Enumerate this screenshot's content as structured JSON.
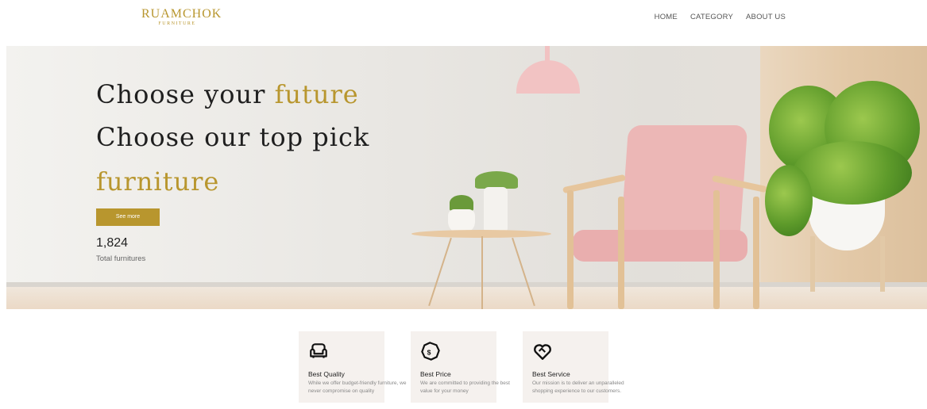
{
  "brand": {
    "name": "RUAMCHOK",
    "tagline": "FURNITURE"
  },
  "nav": {
    "items": [
      {
        "label": "HOME"
      },
      {
        "label": "CATEGORY"
      },
      {
        "label": "ABOUT US"
      }
    ]
  },
  "hero": {
    "line1_prefix": "Choose your ",
    "line1_highlight": "future",
    "line2": "Choose our top pick",
    "line3_highlight": "furniture",
    "cta_label": "See more",
    "stat_value": "1,824",
    "stat_label": "Total furnitures"
  },
  "features": [
    {
      "icon": "armchair-icon",
      "title": "Best Quality",
      "desc": "While we offer budget-friendly furniture, we never compromise on quality"
    },
    {
      "icon": "price-tag-icon",
      "title": "Best Price",
      "desc": "We are committed to providing the best value for your money"
    },
    {
      "icon": "heart-handshake-icon",
      "title": "Best Service",
      "desc": "Our mission is to deliver an unparalleled shopping experience to our customers."
    }
  ],
  "colors": {
    "accent": "#b8962e",
    "text": "#1f1f1f",
    "feature_bg": "#f5f1ee"
  }
}
